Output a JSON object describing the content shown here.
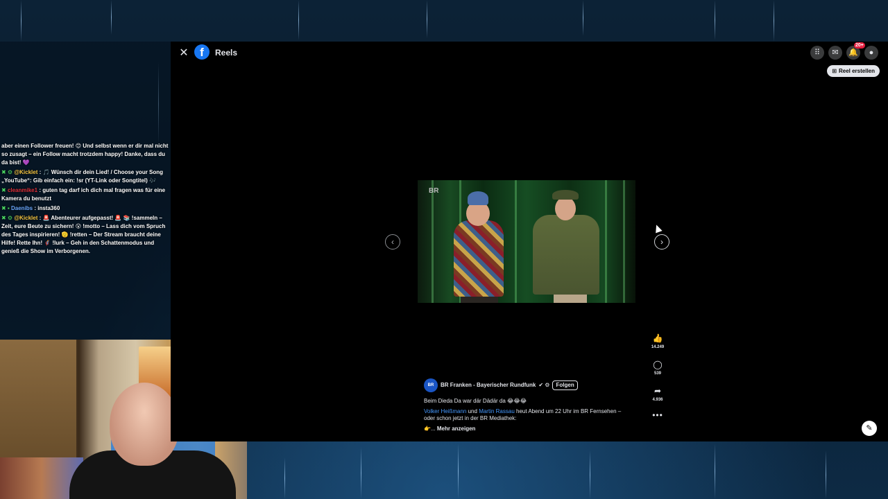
{
  "window": {
    "title": "Reels"
  },
  "toolbar": {
    "reel_create_label": "Reel erstellen",
    "notif_count": "20+"
  },
  "icons": {
    "close": "close-icon",
    "apps": "grid-icon",
    "messenger": "messenger-icon",
    "notifications": "bell-icon",
    "account": "avatar-icon",
    "prev": "chevron-left-icon",
    "next": "chevron-right-icon",
    "like": "thumbs-up-icon",
    "comment": "comment-icon",
    "share": "share-icon",
    "more": "more-icon",
    "edit": "edit-icon"
  },
  "video": {
    "watermark": "BR"
  },
  "actions": {
    "likes": "14.249",
    "comments": "539",
    "shares": "4.936"
  },
  "post": {
    "avatar_label": "BR",
    "author": "BR Franken - Bayerischer Rundfunk",
    "verified_glyph": "✔ ⚙",
    "follow_label": "Folgen",
    "title_line": "Beim Dieda Da war där Dädär da 😂😂😂",
    "tag1": "Volker Heißmann",
    "connector": "und",
    "tag2": "Martin Rassau",
    "body_rest": "heut Abend um 22 Uhr im BR Fernsehen – oder schon jetzt in der BR Mediathek:",
    "more_prefix": "👉...",
    "more_label": "Mehr anzeigen"
  },
  "chat": {
    "line0": "aber einen Follower freuen! 😊 Und selbst wenn er dir mal nicht so zusagt – ein Follow macht trotzdem happy! Danke, dass du da bist! 💜",
    "line1_user": "@Kicklet",
    "line1_text": ": 🎵 Wünsch dir dein Lied! / Choose your Song „YouTube“: Gib einfach ein: !sr (YT-Link oder Songtitel) 🎶",
    "line2_user": "cleanmike1",
    "line2_text": ": guten tag darf ich dich mal fragen was für eine Kamera du benutzt",
    "line3_user": "Daenibs",
    "line3_text": ": insta360",
    "line4_user": "@Kicklet",
    "line4_text": ": 🚨 Abenteurer aufgepasst! 🚨 📚 !sammeln – Zeit, eure Beute zu sichern! 😮 !motto – Lass dich vom Spruch des Tages inspirieren! 🫡 !retten – Der Stream braucht deine Hilfe! Rette Ihn! 🦸 !lurk – Geh in den Schattenmodus und genieß die Show im Verborgenen."
  }
}
